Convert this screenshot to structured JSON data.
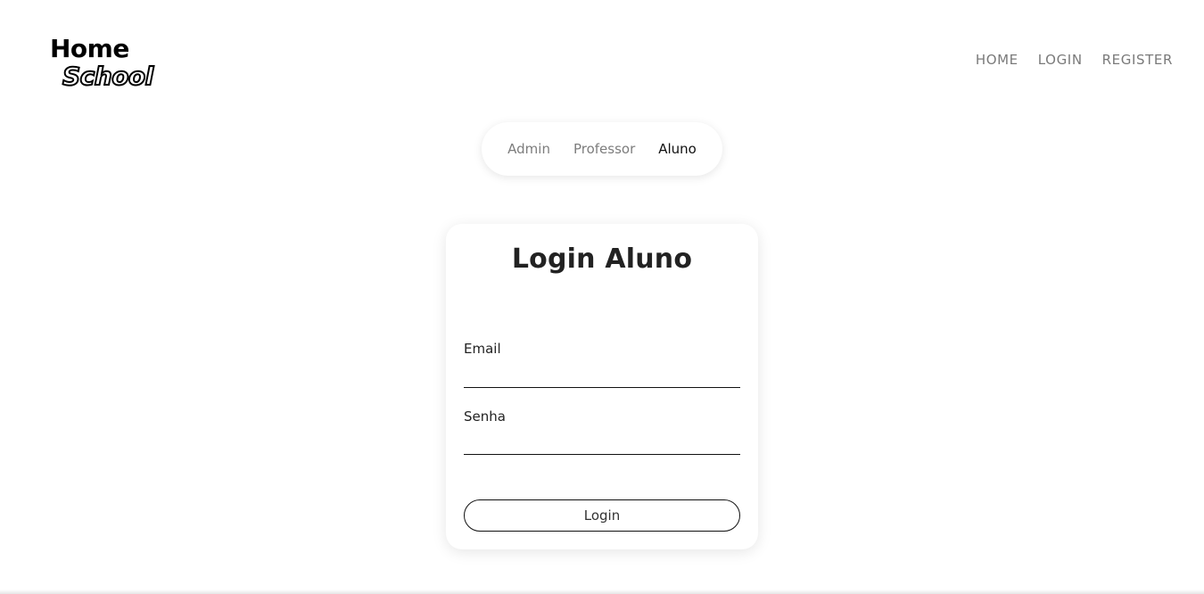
{
  "logo": {
    "line1": "Home",
    "line2": "School"
  },
  "nav": {
    "items": [
      {
        "label": "HOME"
      },
      {
        "label": "LOGIN"
      },
      {
        "label": "REGISTER"
      }
    ]
  },
  "roles": {
    "items": [
      {
        "label": "Admin"
      },
      {
        "label": "Professor"
      },
      {
        "label": "Aluno"
      }
    ],
    "selected": "Aluno"
  },
  "login_form": {
    "title": "Login Aluno",
    "email_label": "Email",
    "email_value": "",
    "password_label": "Senha",
    "password_value": "",
    "submit_label": "Login"
  }
}
